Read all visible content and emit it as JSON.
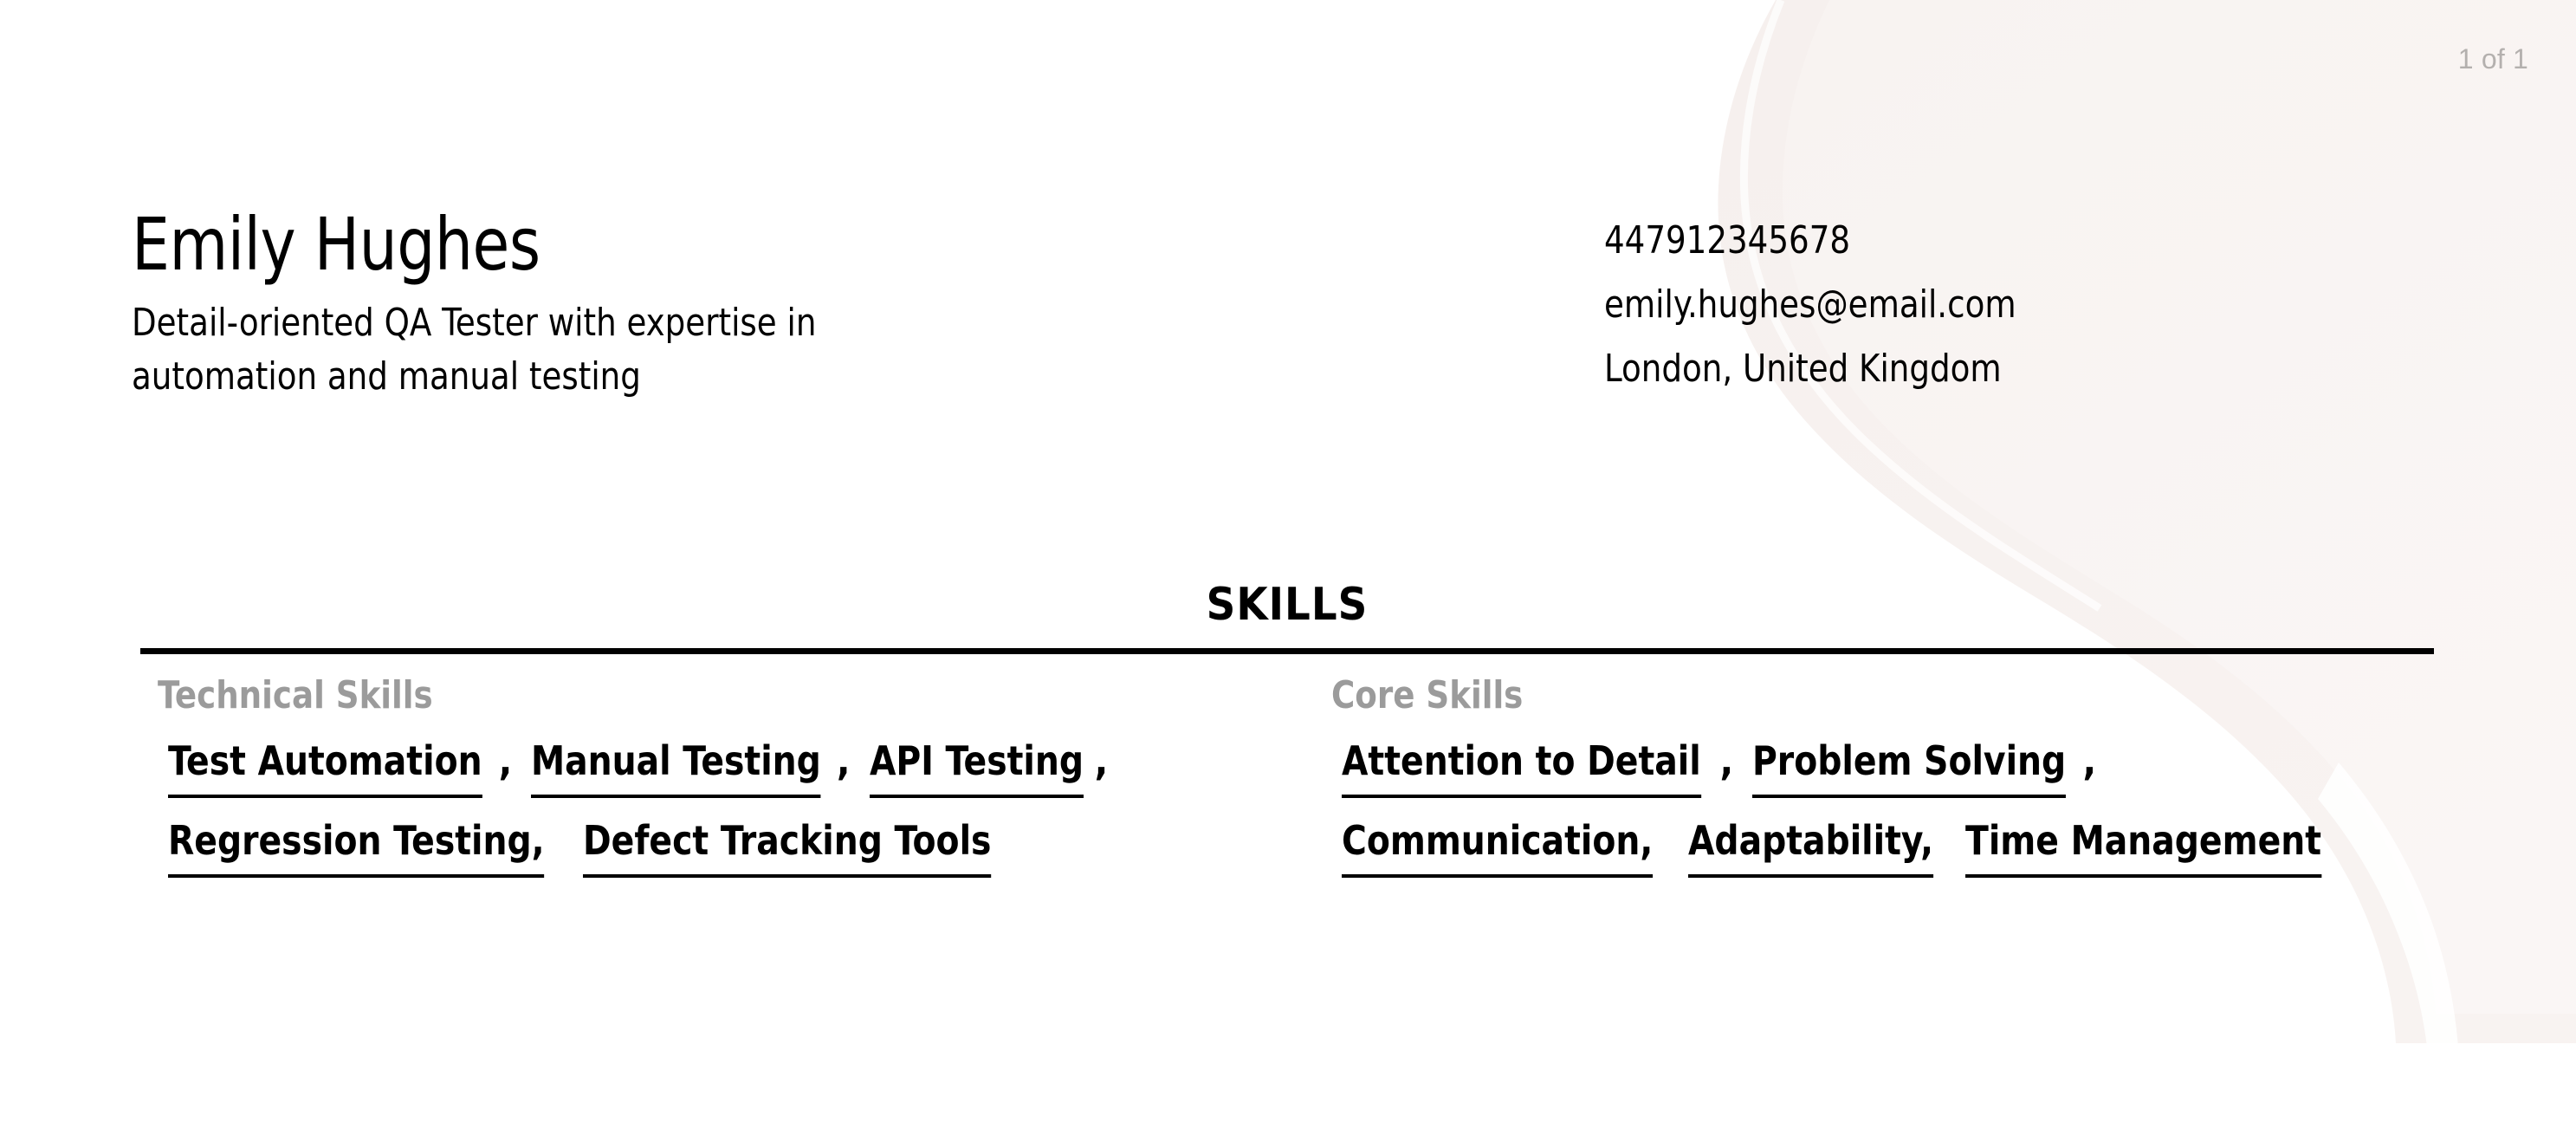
{
  "viewer": {
    "page_counter": "1 of 1"
  },
  "colors": {
    "text": "#000000",
    "muted_label": "#9b9b9b",
    "page_counter": "#b4b0ae",
    "decor_blob": "#f7f2f0",
    "decor_blob_light": "#fbf8f7",
    "rule": "#000000",
    "page_background": "#ffffff"
  },
  "resume": {
    "name": "Emily Hughes",
    "headline": "Detail-oriented QA Tester with expertise in automation and manual testing",
    "contact": {
      "phone": "447912345678",
      "email": "emily.hughes@email.com",
      "location": "London, United Kingdom"
    },
    "sections": [
      {
        "title": "SKILLS",
        "columns": [
          {
            "label": "Technical Skills",
            "rows": [
              [
                {
                  "name": "Test Automation",
                  "separator": ",",
                  "separator_underlined": false
                },
                {
                  "name": "Manual Testing",
                  "separator": ",",
                  "separator_underlined": false
                },
                {
                  "name": "API Testing",
                  "separator": ",",
                  "separator_underlined": false
                }
              ],
              [
                {
                  "name": "Regression Testing",
                  "separator": ",",
                  "separator_underlined": true
                },
                {
                  "name": "Defect Tracking Tools",
                  "separator": "",
                  "separator_underlined": false
                }
              ]
            ]
          },
          {
            "label": "Core Skills",
            "rows": [
              [
                {
                  "name": "Attention to Detail",
                  "separator": ",",
                  "separator_underlined": false
                },
                {
                  "name": "Problem Solving",
                  "separator": ",",
                  "separator_underlined": false
                }
              ],
              [
                {
                  "name": "Communication",
                  "separator": ",",
                  "separator_underlined": true
                },
                {
                  "name": "Adaptability",
                  "separator": ",",
                  "separator_underlined": true
                },
                {
                  "name": "Time Management",
                  "separator": "",
                  "separator_underlined": false
                }
              ]
            ]
          }
        ]
      }
    ]
  }
}
